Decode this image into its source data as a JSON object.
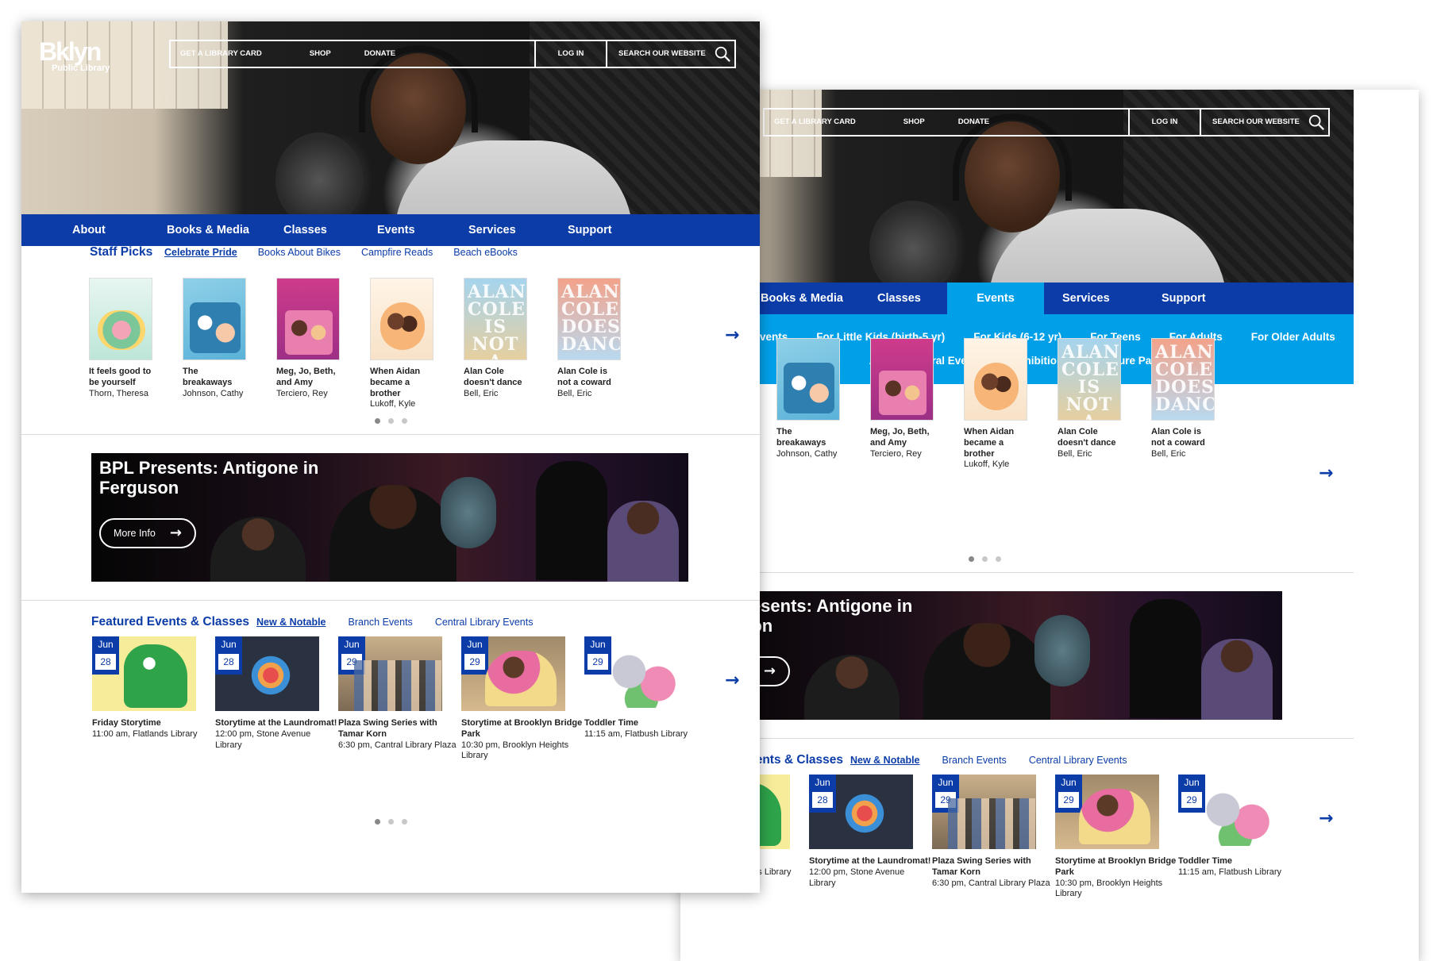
{
  "site": {
    "logo_big": "Bklyn",
    "logo_small": "Public Library",
    "util": {
      "card": "GET A LIBRARY CARD",
      "shop": "SHOP",
      "donate": "DONATE",
      "login": "LOG IN",
      "search": "SEARCH OUR WEBSITE"
    },
    "nav": [
      "About",
      "Books & Media",
      "Classes",
      "Events",
      "Services",
      "Support"
    ],
    "events_subnav_row1": [
      "Upcoming Events",
      "For Little Kids (birth-5 yr)",
      "For Kids (6-12 yr)",
      "For Teens",
      "For Adults",
      "For Older Adults"
    ],
    "events_subnav_row2": [
      "Arts & Cultural Events",
      "Exhibitions",
      "Culture Pass"
    ]
  },
  "staff_picks": {
    "title": "Staff Picks",
    "tabs": [
      "Celebrate Pride",
      "Books About Bikes",
      "Campfire Reads",
      "Beach eBooks"
    ],
    "books": [
      {
        "title": "It feels good to be yourself",
        "author": "Thorn, Theresa"
      },
      {
        "title": "The breakaways",
        "author": "Johnson, Cathy"
      },
      {
        "title": "Meg, Jo, Beth, and Amy",
        "author": "Terciero, Rey"
      },
      {
        "title": "When Aidan became a brother",
        "author": "Lukoff, Kyle"
      },
      {
        "title": "Alan Cole doesn't dance",
        "author": "Bell, Eric"
      },
      {
        "title": "Alan Cole is not a coward",
        "author": "Bell, Eric"
      }
    ],
    "cover5_text": "ALAN COLE IS NOT A COWARD",
    "cover6_text": "ALAN COLE DOESN'T DANCE"
  },
  "promo": {
    "title": "BPL Presents: Antigone in Ferguson",
    "button": "More Info"
  },
  "featured": {
    "title": "Featured Events & Classes",
    "tabs": [
      "New & Notable",
      "Branch Events",
      "Central Library Events"
    ],
    "events": [
      {
        "month": "Jun",
        "day": "28",
        "title": "Friday Storytime",
        "detail": "11:00 am, Flatlands Library"
      },
      {
        "month": "Jun",
        "day": "28",
        "title": "Storytime at the Laundromat!",
        "detail": "12:00 pm, Stone Avenue Library"
      },
      {
        "month": "Jun",
        "day": "29",
        "title": "Plaza Swing Series with Tamar Korn",
        "detail": "6:30 pm, Cantral Library Plaza"
      },
      {
        "month": "Jun",
        "day": "29",
        "title": "Storytime at Brooklyn Bridge Park",
        "detail": "10:30 pm, Brooklyn Heights Library"
      },
      {
        "month": "Jun",
        "day": "29",
        "title": "Toddler Time",
        "detail": "11:15 am, Flatbush Library"
      }
    ]
  },
  "icons": {
    "search": "search-icon",
    "next": "arrow-right-icon",
    "more": "arrow-right-icon"
  },
  "colors": {
    "brand_blue": "#0b3ca8",
    "events_cyan": "#00a0e9"
  }
}
